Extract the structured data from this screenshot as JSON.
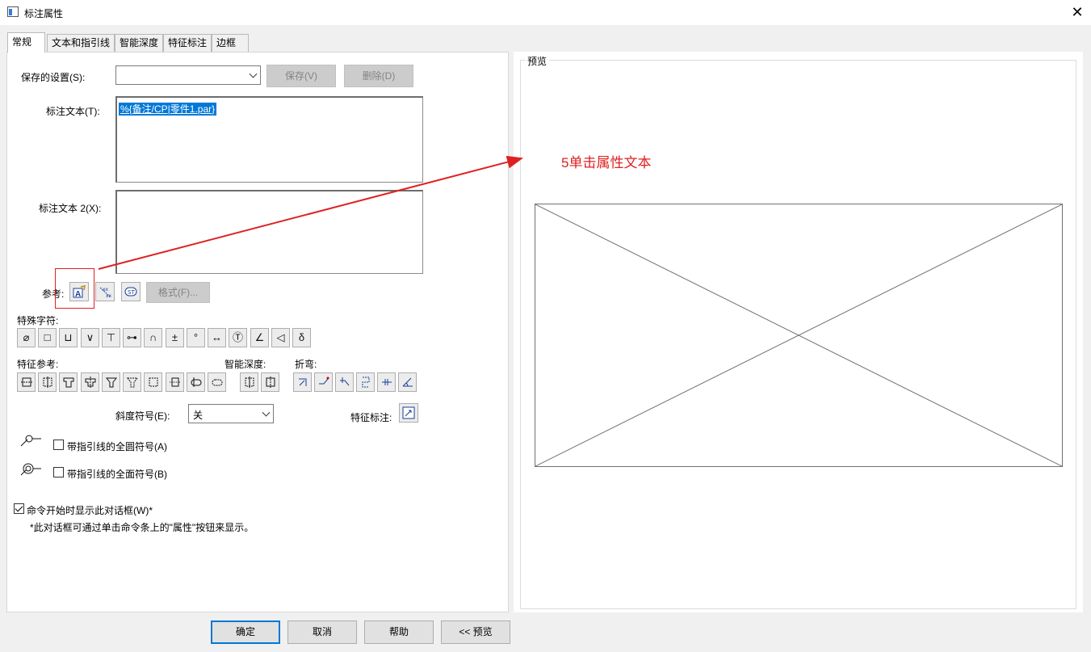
{
  "window": {
    "title": "标注属性",
    "close_glyph": "✕"
  },
  "tabs": [
    {
      "label": "常规",
      "active": true
    },
    {
      "label": "文本和指引线"
    },
    {
      "label": "智能深度"
    },
    {
      "label": "特征标注"
    },
    {
      "label": "边框"
    }
  ],
  "general": {
    "saved_settings_label": "保存的设置(S):",
    "saved_settings_value": "",
    "save_button": "保存(V)",
    "delete_button": "删除(D)",
    "callout_text_label": "标注文本(T):",
    "callout_text_value": "%{备注/CP|零件1.par}",
    "callout_text2_label": "标注文本 2(X):",
    "callout_text2_value": "",
    "reference_label": "参考:",
    "format_button": "格式(F)...",
    "special_chars_label": "特殊字符:",
    "special_chars": [
      "⌀",
      "□",
      "⊔",
      "∨",
      "⊤",
      "⊶",
      "∩",
      "±",
      "°",
      "↔",
      "Ⓣ",
      "∠",
      "◁",
      "δ"
    ],
    "feature_ref_label": "特征参考:",
    "smart_depth_label": "智能深度:",
    "bend_label": "折弯:",
    "slope_label": "斜度符号(E):",
    "slope_value": "关",
    "feature_callout_label": "特征标注:",
    "all_around_label": "带指引线的全圆符号(A)",
    "all_over_label": "带指引线的全面符号(B)",
    "show_dialog_label": "命令开始时显示此对话框(W)*",
    "show_dialog_checked": true,
    "note_text": "*此对话框可通过单击命令条上的\"属性\"按钮来显示。"
  },
  "preview": {
    "label": "预览"
  },
  "annotation": {
    "text": "5单击属性文本",
    "color": "#e02020"
  },
  "footer": {
    "ok": "确定",
    "cancel": "取消",
    "help": "帮助",
    "preview": "<< 预览"
  },
  "icons": {
    "feature_ref": [
      "counterbore-icon",
      "counterbore-hidden-icon",
      "spotface-icon",
      "spotface-depth-icon",
      "countersink-icon",
      "countersink-hidden-icon",
      "hole-hidden-icon",
      "thread-hole-icon",
      "slot-icon",
      "slot-hidden-icon"
    ],
    "smart_depth": [
      "depth-hole-icon",
      "depth-thread-icon"
    ],
    "bend": [
      "bend-direction-icon",
      "bend-up-icon",
      "bend-down-icon",
      "bend-split-icon",
      "bend-radius-icon",
      "bend-angle-icon"
    ]
  }
}
